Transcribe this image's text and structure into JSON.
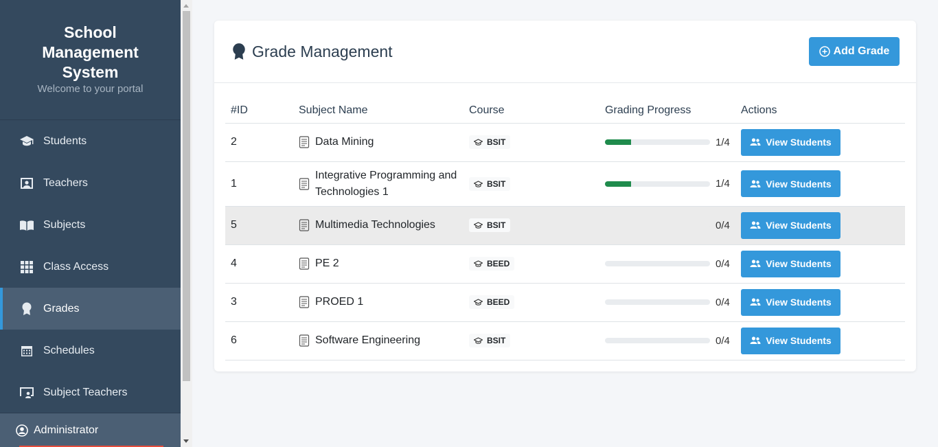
{
  "sidebar": {
    "title": "School Management System",
    "subtitle": "Welcome to your portal",
    "items": [
      {
        "label": "Students",
        "icon": "graduation-cap-icon"
      },
      {
        "label": "Teachers",
        "icon": "id-badge-icon"
      },
      {
        "label": "Subjects",
        "icon": "book-open-icon"
      },
      {
        "label": "Class Access",
        "icon": "grid-icon"
      },
      {
        "label": "Grades",
        "icon": "award-icon",
        "active": true
      },
      {
        "label": "Schedules",
        "icon": "calendar-icon"
      },
      {
        "label": "Subject Teachers",
        "icon": "chalkboard-teacher-icon"
      }
    ],
    "user": "Administrator"
  },
  "header": {
    "title": "Grade Management",
    "add_button": "Add Grade"
  },
  "table": {
    "columns": [
      "#ID",
      "Subject Name",
      "Course",
      "Grading Progress",
      "Actions"
    ],
    "action_label": "View Students",
    "rows": [
      {
        "id": "2",
        "subject": "Data Mining",
        "course": "BSIT",
        "progress": "1/4",
        "fraction": 0.25
      },
      {
        "id": "1",
        "subject": "Integrative Programming and Technologies 1",
        "course": "BSIT",
        "progress": "1/4",
        "fraction": 0.25
      },
      {
        "id": "5",
        "subject": "Multimedia Technologies",
        "course": "BSIT",
        "progress": "0/4",
        "fraction": 0
      },
      {
        "id": "4",
        "subject": "PE 2",
        "course": "BEED",
        "progress": "0/4",
        "fraction": 0
      },
      {
        "id": "3",
        "subject": "PROED 1",
        "course": "BEED",
        "progress": "0/4",
        "fraction": 0
      },
      {
        "id": "6",
        "subject": "Software Engineering",
        "course": "BSIT",
        "progress": "0/4",
        "fraction": 0
      }
    ]
  },
  "colors": {
    "sidebar_bg": "#34495e",
    "accent": "#3498db",
    "progress_fill": "#1f8b4c"
  }
}
